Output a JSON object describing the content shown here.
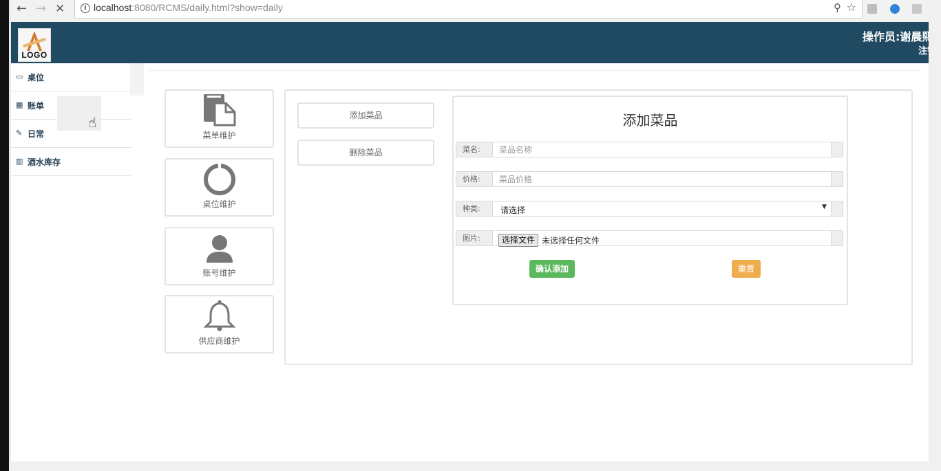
{
  "browser": {
    "url_host": "localhost",
    "url_rest": ":8080/RCMS/daily.html?show=daily",
    "back_icon": "←",
    "forward_icon": "→",
    "stop_icon": "✕",
    "info_icon": "i",
    "zoom_icon": "⚲",
    "star_icon": "☆"
  },
  "header": {
    "logo_text": "LOGO",
    "operator": "操作员:谢晨熙",
    "logout": "注销",
    "background": "#204962"
  },
  "sidebar": {
    "items": [
      {
        "icon": "▭",
        "label": "桌位"
      },
      {
        "icon": "▦",
        "label": "账单"
      },
      {
        "icon": "✎",
        "label": "日常"
      },
      {
        "icon": "▥",
        "label": "酒水库存"
      }
    ]
  },
  "cards": [
    {
      "icon": "file-icon",
      "label": "菜单维护"
    },
    {
      "icon": "ring-icon",
      "label": "桌位维护"
    },
    {
      "icon": "user-icon",
      "label": "账号维护"
    },
    {
      "icon": "bell-icon",
      "label": "供应商维护"
    }
  ],
  "actions": {
    "add_dish": "添加菜品",
    "delete_dish": "删除菜品"
  },
  "form": {
    "title": "添加菜品",
    "name_label": "菜名:",
    "name_placeholder": "菜品名称",
    "price_label": "价格:",
    "price_placeholder": "菜品价格",
    "category_label": "种类:",
    "category_value": "请选择",
    "image_label": "图片:",
    "file_button": "选择文件",
    "file_none": "未选择任何文件",
    "confirm": "确认添加",
    "reset": "重置"
  },
  "colors": {
    "confirm": "#5cb85c",
    "reset": "#f0ad4e"
  }
}
